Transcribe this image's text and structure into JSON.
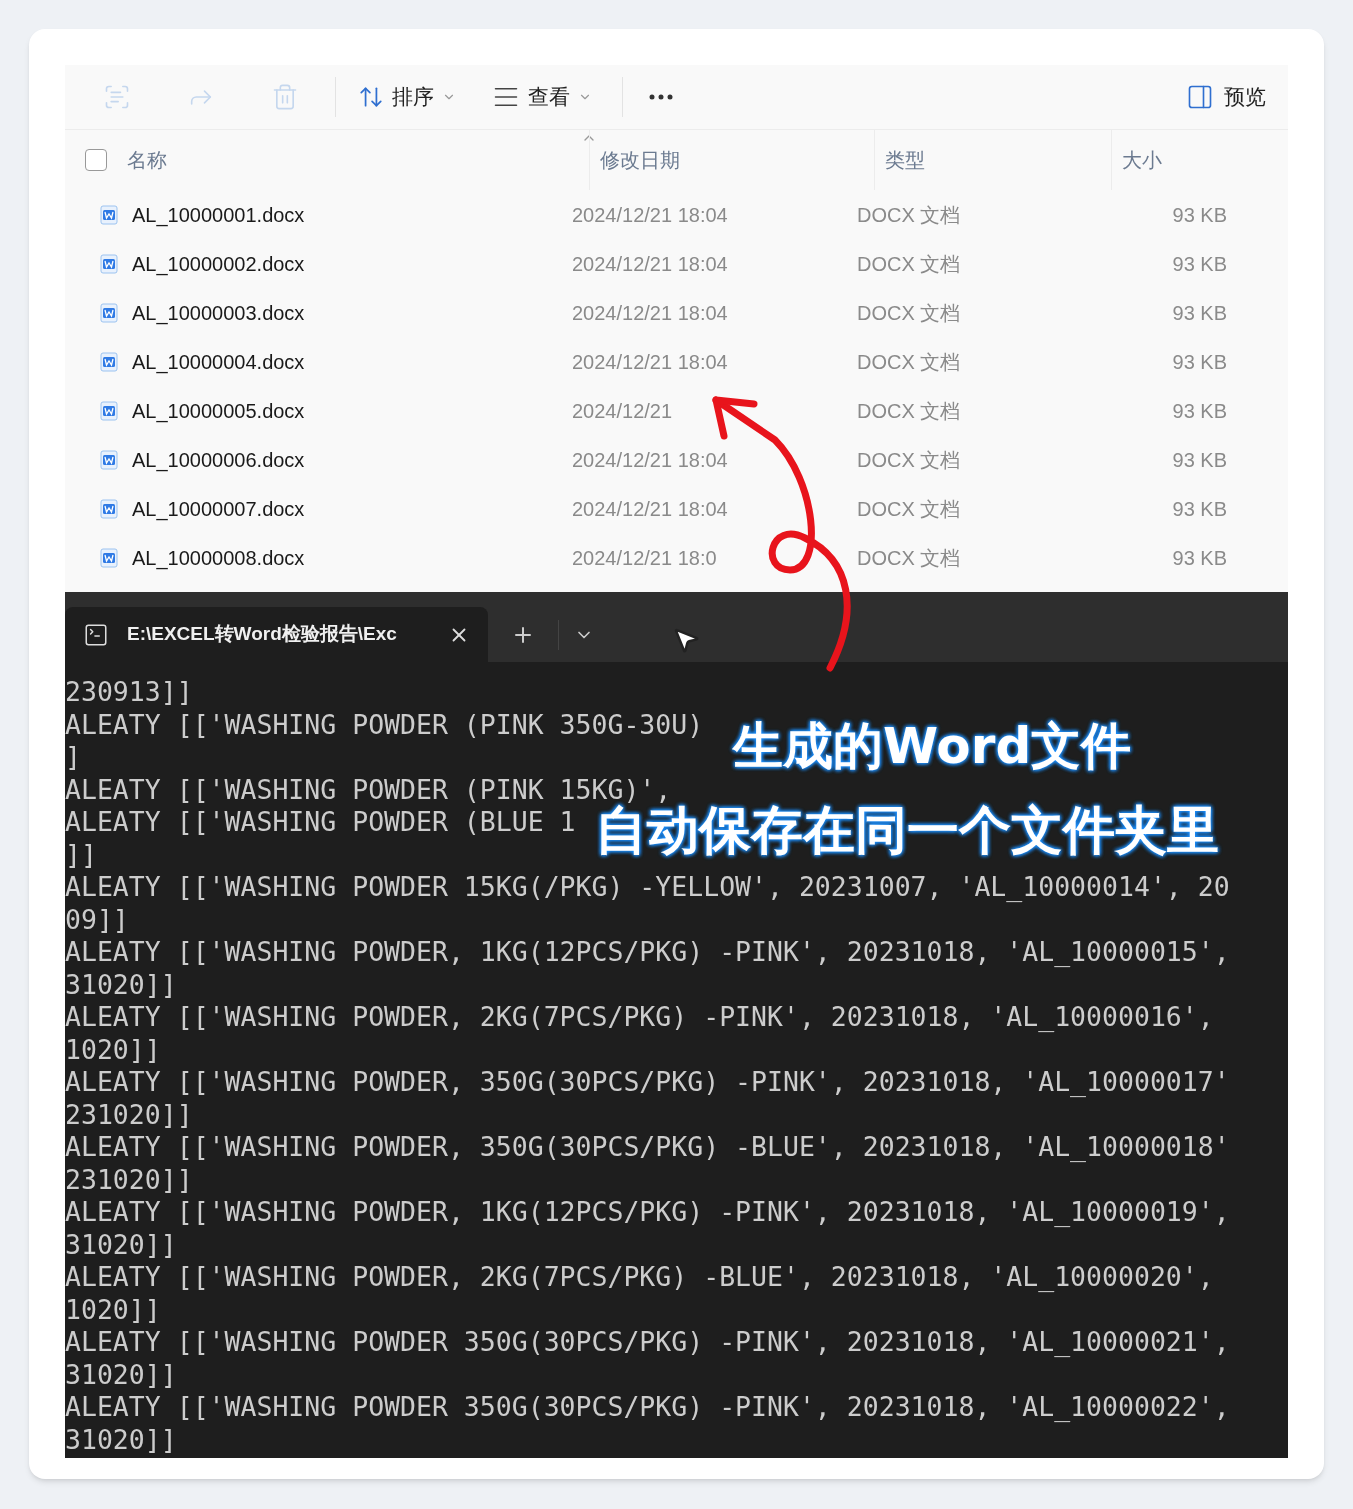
{
  "explorer": {
    "toolbar": {
      "actions": [
        {
          "disabled": true
        },
        {
          "disabled": true
        },
        {
          "disabled": true
        }
      ],
      "sort": {
        "label": "排序"
      },
      "view": {
        "label": "查看"
      },
      "preview": {
        "label": "预览"
      }
    },
    "header": {
      "checked": false,
      "columns": [
        {
          "label": "名称",
          "sorted": true
        },
        {
          "label": "修改日期",
          "sorted": false
        },
        {
          "label": "类型",
          "sorted": false
        },
        {
          "label": "大小",
          "sorted": false
        }
      ]
    },
    "rows": [
      {
        "name": "AL_10000001.docx",
        "modified": "2024/12/21 18:04",
        "type": "DOCX 文档",
        "size": "93 KB"
      },
      {
        "name": "AL_10000002.docx",
        "modified": "2024/12/21 18:04",
        "type": "DOCX 文档",
        "size": "93 KB"
      },
      {
        "name": "AL_10000003.docx",
        "modified": "2024/12/21 18:04",
        "type": "DOCX 文档",
        "size": "93 KB"
      },
      {
        "name": "AL_10000004.docx",
        "modified": "2024/12/21 18:04",
        "type": "DOCX 文档",
        "size": "93 KB"
      },
      {
        "name": "AL_10000005.docx",
        "modified": "2024/12/21",
        "type": "DOCX 文档",
        "size": "93 KB"
      },
      {
        "name": "AL_10000006.docx",
        "modified": "2024/12/21 18:04",
        "type": "DOCX 文档",
        "size": "93 KB"
      },
      {
        "name": "AL_10000007.docx",
        "modified": "2024/12/21 18:04",
        "type": "DOCX 文档",
        "size": "93 KB"
      },
      {
        "name": "AL_10000008.docx",
        "modified": "2024/12/21 18:0",
        "type": "DOCX 文档",
        "size": "93 KB"
      }
    ]
  },
  "terminal": {
    "tab": {
      "title": "E:\\EXCEL转Word检验报告\\Exc",
      "selected": true
    },
    "lines": [
      "230913]]",
      "ALEATY [['WASHING POWDER (PINK 350G-30U)",
      "]",
      "ALEATY [['WASHING POWDER (PINK 15KG)',",
      "ALEATY [['WASHING POWDER (BLUE 1",
      "]]",
      "ALEATY [['WASHING POWDER 15KG(/PKG) -YELLOW', 20231007, 'AL_10000014', 20",
      "09]]",
      "ALEATY [['WASHING POWDER, 1KG(12PCS/PKG) -PINK', 20231018, 'AL_10000015',",
      "31020]]",
      "ALEATY [['WASHING POWDER, 2KG(7PCS/PKG) -PINK', 20231018, 'AL_10000016',",
      "1020]]",
      "ALEATY [['WASHING POWDER, 350G(30PCS/PKG) -PINK', 20231018, 'AL_10000017'",
      "231020]]",
      "ALEATY [['WASHING POWDER, 350G(30PCS/PKG) -BLUE', 20231018, 'AL_10000018'",
      "231020]]",
      "ALEATY [['WASHING POWDER, 1KG(12PCS/PKG) -PINK', 20231018, 'AL_10000019',",
      "31020]]",
      "ALEATY [['WASHING POWDER, 2KG(7PCS/PKG) -BLUE', 20231018, 'AL_10000020',",
      "1020]]",
      "ALEATY [['WASHING POWDER 350G(30PCS/PKG) -PINK', 20231018, 'AL_10000021',",
      "31020]]",
      "ALEATY [['WASHING POWDER 350G(30PCS/PKG) -PINK', 20231018, 'AL_10000022',",
      "31020]]"
    ]
  },
  "caption": [
    "生成的Word文件",
    "自动保存在同一个文件夹里"
  ]
}
